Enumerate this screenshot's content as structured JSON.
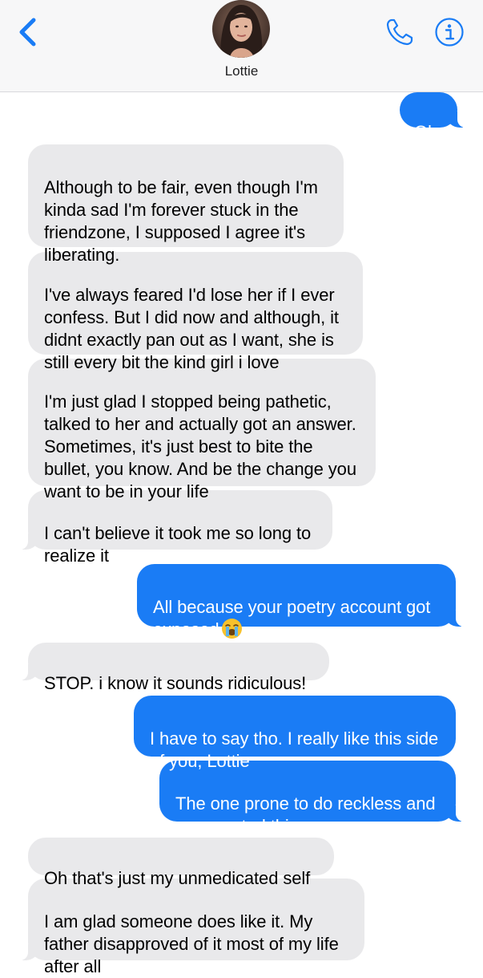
{
  "header": {
    "contact_name": "Lottie",
    "back_icon": "chevron-left-icon",
    "call_icon": "phone-icon",
    "info_icon": "info-icon",
    "accent_color": "#1a7cf5"
  },
  "messages": [
    {
      "direction": "outgoing",
      "text": "Oh"
    },
    {
      "direction": "incoming",
      "text": "Although to be fair, even though I'm kinda sad I'm forever stuck in the friendzone, I supposed I agree it's liberating."
    },
    {
      "direction": "incoming",
      "text": "I've always feared I'd lose her if I ever confess. But I did now and although, it didnt exactly pan out as I want, she is still every bit the kind girl i love"
    },
    {
      "direction": "incoming",
      "text": "I'm just glad I stopped being pathetic, talked to her and actually got an answer. Sometimes, it's just best to bite the bullet, you know. And be the change you want to be in your life"
    },
    {
      "direction": "incoming",
      "text": "I can't believe it took me so long to realize it"
    },
    {
      "direction": "outgoing",
      "text": "All because your poetry account got exposed",
      "emoji": "loudly-crying-face-emoji"
    },
    {
      "direction": "incoming",
      "text": "STOP. i know it sounds ridiculous!"
    },
    {
      "direction": "outgoing",
      "text": "I have to say tho. I really like this side of you, Lottie"
    },
    {
      "direction": "outgoing",
      "text": "The one prone to do reckless and unexpected things."
    },
    {
      "direction": "incoming",
      "text": "Oh that's just my unmedicated self"
    },
    {
      "direction": "incoming",
      "text": "I am glad someone does like it. My father disapproved of it most of my life after all"
    }
  ]
}
